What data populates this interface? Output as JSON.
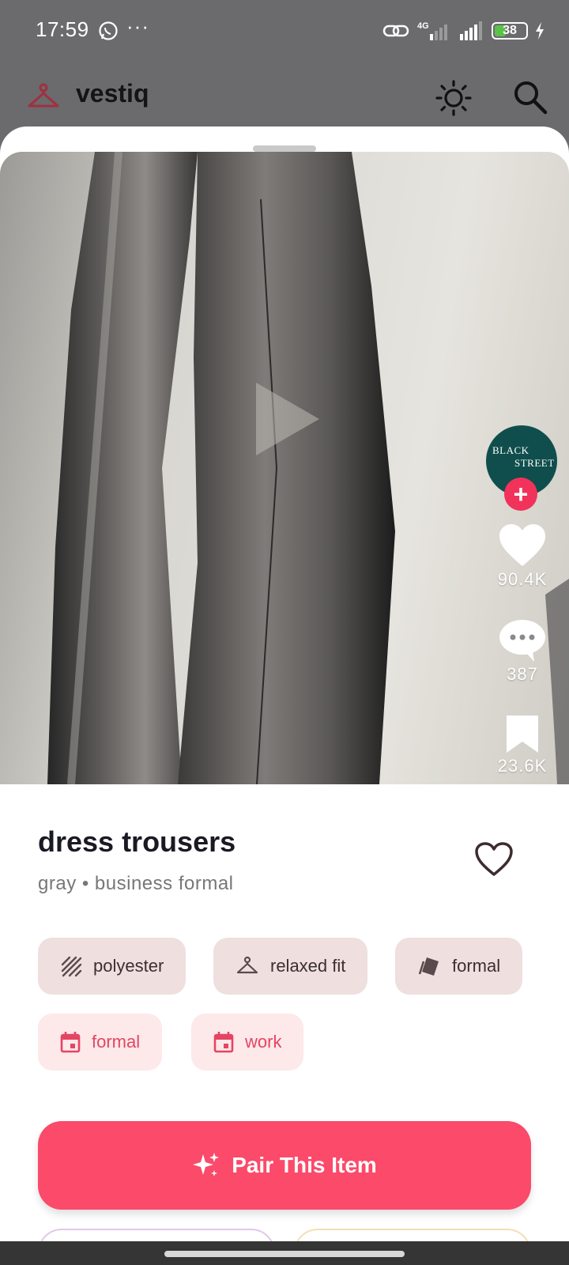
{
  "status_bar": {
    "time": "17:59",
    "more": "···",
    "battery_percent": 38,
    "battery_label": "38",
    "network": "4G",
    "icons": [
      "whatsapp-icon",
      "link-icon",
      "signal-4g-icon",
      "signal-icon",
      "battery-icon",
      "charging-icon"
    ]
  },
  "app_bar": {
    "title": "vestiq",
    "logo_icon": "hanger-icon",
    "actions": [
      "theme-toggle-icon",
      "search-icon"
    ]
  },
  "video": {
    "brand": {
      "line1": "BLACK",
      "line2": "STREET"
    },
    "likes": "90.4K",
    "comments": "387",
    "saves": "23.6K"
  },
  "item": {
    "name": "dress trousers",
    "subtitle": "gray • business formal",
    "attributes": [
      {
        "label": "polyester",
        "icon": "texture-icon"
      },
      {
        "label": "relaxed fit",
        "icon": "hanger-icon"
      },
      {
        "label": "formal",
        "icon": "style-icon"
      }
    ],
    "occasions": [
      {
        "label": "formal",
        "icon": "calendar-icon"
      },
      {
        "label": "work",
        "icon": "calendar-icon"
      }
    ]
  },
  "cta": {
    "label": "Pair This Item",
    "icon": "sparkle-icon"
  },
  "colors": {
    "accent": "#fb4a6a",
    "attr_chip_bg": "#efdfdf",
    "occasion_chip_bg": "#fde8ea",
    "occasion_text": "#e44563",
    "brand_avatar": "#0f4e4c"
  }
}
